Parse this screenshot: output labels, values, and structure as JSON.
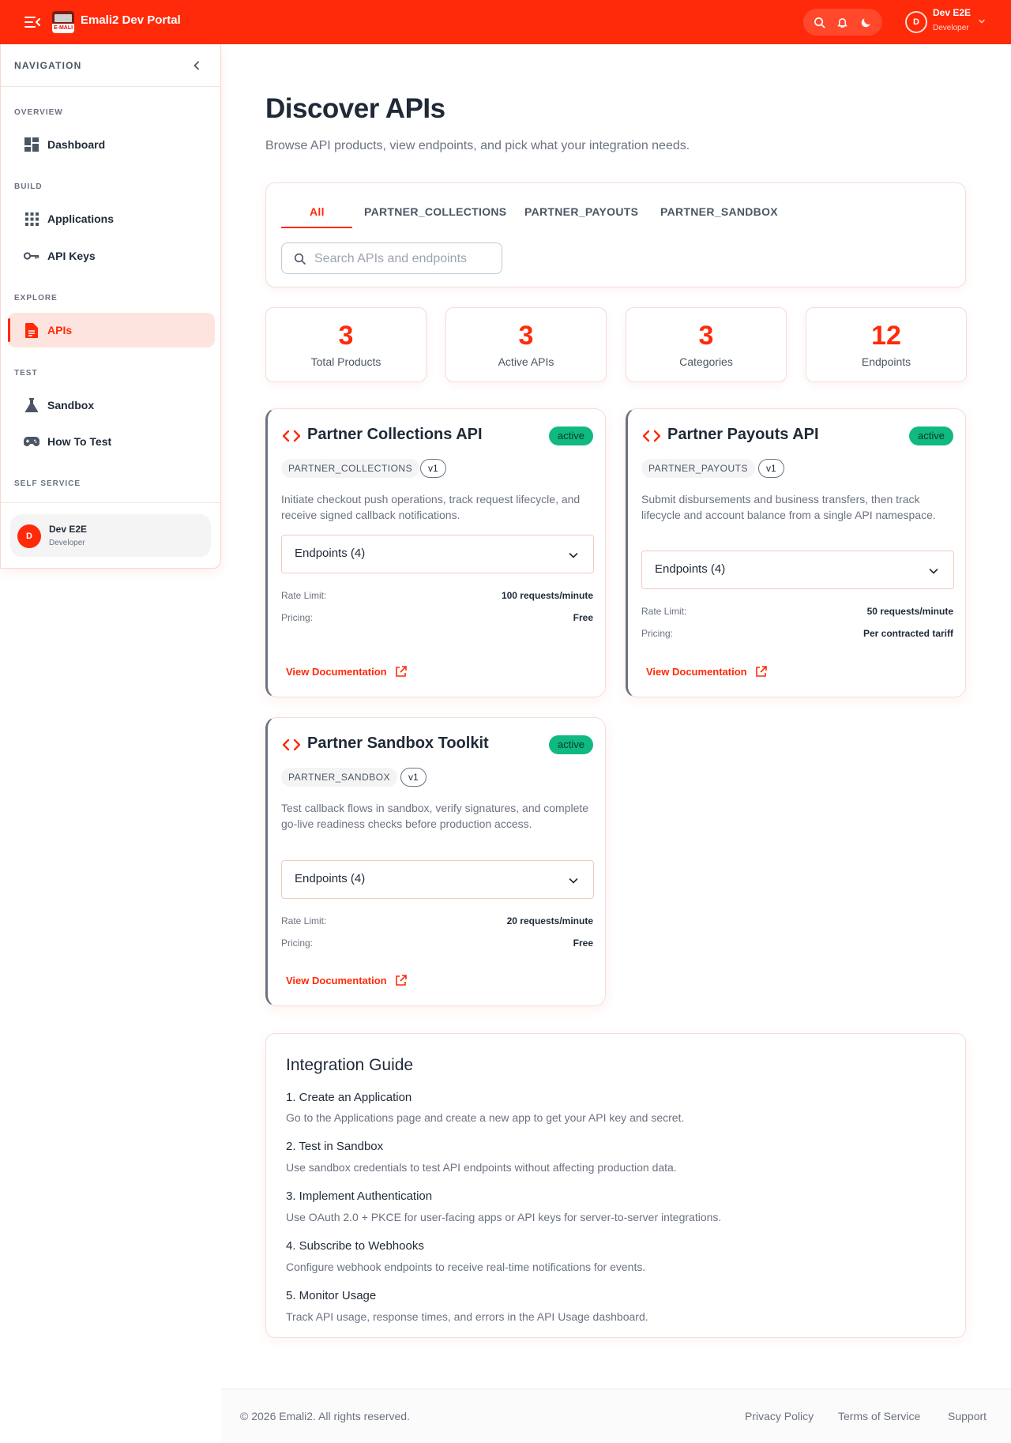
{
  "header": {
    "brand": "Emali2 Dev Portal",
    "logo_text": "E-MALI",
    "user": {
      "initial": "D",
      "name": "Dev E2E",
      "role": "Developer"
    },
    "icons": [
      "menu-collapse-icon",
      "search-icon",
      "bell-icon",
      "moon-icon",
      "chevron-down-icon"
    ]
  },
  "sidebar": {
    "title": "NAVIGATION",
    "sections": {
      "overview": "OVERVIEW",
      "build": "BUILD",
      "explore": "EXPLORE",
      "test": "TEST",
      "self_service": "SELF SERVICE"
    },
    "items": {
      "dashboard": "Dashboard",
      "applications": "Applications",
      "api_keys": "API Keys",
      "apis": "APIs",
      "sandbox": "Sandbox",
      "how_to_test": "How To Test"
    },
    "active_item": "APIs",
    "user": {
      "initial": "D",
      "name": "Dev E2E",
      "role": "Developer"
    }
  },
  "main": {
    "title": "Discover APIs",
    "subtitle": "Browse API products, view endpoints, and pick what your integration needs.",
    "tabs": [
      "All",
      "PARTNER_COLLECTIONS",
      "PARTNER_PAYOUTS",
      "PARTNER_SANDBOX"
    ],
    "active_tab": "All",
    "search": {
      "placeholder": "Search APIs and endpoints",
      "value": ""
    },
    "stats": [
      {
        "value": "3",
        "label": "Total Products"
      },
      {
        "value": "3",
        "label": "Active APIs"
      },
      {
        "value": "3",
        "label": "Categories"
      },
      {
        "value": "12",
        "label": "Endpoints"
      }
    ],
    "apis": [
      {
        "name": "Partner Collections API",
        "status": "active",
        "category": "PARTNER_COLLECTIONS",
        "version": "v1",
        "description": "Initiate checkout push operations, track request lifecycle, and receive signed callback notifications.",
        "endpoints_label": "Endpoints (4)",
        "rate_limit_label": "Rate Limit:",
        "rate_limit": "100 requests/minute",
        "pricing_label": "Pricing:",
        "pricing": "Free",
        "doc_link": "View Documentation"
      },
      {
        "name": "Partner Payouts API",
        "status": "active",
        "category": "PARTNER_PAYOUTS",
        "version": "v1",
        "description": "Submit disbursements and business transfers, then track lifecycle and account balance from a single API namespace.",
        "endpoints_label": "Endpoints (4)",
        "rate_limit_label": "Rate Limit:",
        "rate_limit": "50 requests/minute",
        "pricing_label": "Pricing:",
        "pricing": "Per contracted tariff",
        "doc_link": "View Documentation"
      },
      {
        "name": "Partner Sandbox Toolkit",
        "status": "active",
        "category": "PARTNER_SANDBOX",
        "version": "v1",
        "description": "Test callback flows in sandbox, verify signatures, and complete go-live readiness checks before production access.",
        "endpoints_label": "Endpoints (4)",
        "rate_limit_label": "Rate Limit:",
        "rate_limit": "20 requests/minute",
        "pricing_label": "Pricing:",
        "pricing": "Free",
        "doc_link": "View Documentation"
      }
    ],
    "guide": {
      "title": "Integration Guide",
      "steps": [
        {
          "title": "1. Create an Application",
          "text": "Go to the Applications page and create a new app to get your API key and secret."
        },
        {
          "title": "2. Test in Sandbox",
          "text": "Use sandbox credentials to test API endpoints without affecting production data."
        },
        {
          "title": "3. Implement Authentication",
          "text": "Use OAuth 2.0 + PKCE for user-facing apps or API keys for server-to-server integrations."
        },
        {
          "title": "4. Subscribe to Webhooks",
          "text": "Configure webhook endpoints to receive real-time notifications for events."
        },
        {
          "title": "5. Monitor Usage",
          "text": "Track API usage, response times, and errors in the API Usage dashboard."
        }
      ]
    }
  },
  "footer": {
    "copyright": "© 2026 Emali2. All rights reserved.",
    "links": [
      "Privacy Policy",
      "Terms of Service",
      "Support"
    ]
  },
  "colors": {
    "brand": "#ff2a0a",
    "active_badge": "#10b981",
    "active_nav_bg": "#fee4de",
    "text_primary": "#1f2937",
    "text_muted": "#6b7280"
  }
}
